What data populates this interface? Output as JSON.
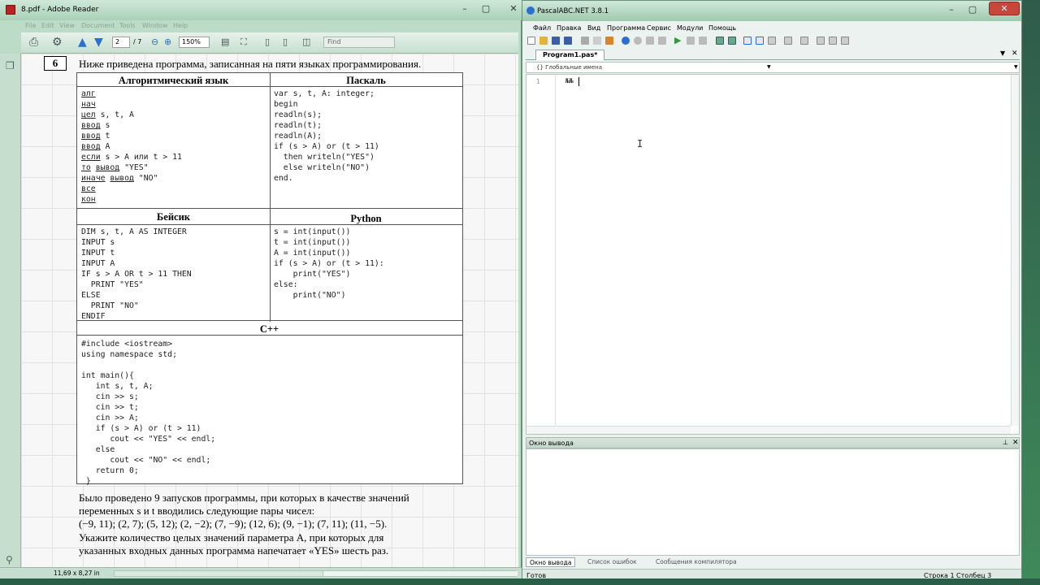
{
  "reader": {
    "title": "8.pdf - Adobe Reader",
    "menu": [
      "File",
      "Edit",
      "View",
      "Document",
      "Tools",
      "Window",
      "Help"
    ],
    "toolbar": {
      "page_value": "2",
      "page_total": "/ 7",
      "zoom_value": "150%",
      "find_placeholder": "Find"
    },
    "page": {
      "task_number": "6",
      "intro": "Ниже приведена программа, записанная на пяти языках программирования.",
      "headers": {
        "algo": "Алгоритмический язык",
        "pascal": "Паскаль",
        "basic": "Бейсик",
        "python": "Python",
        "cpp": "C++"
      },
      "code_algo": [
        {
          "kw": "алг",
          "rest": ""
        },
        {
          "kw": "нач",
          "rest": ""
        },
        {
          "kw": "цел",
          "rest": " s, t, A"
        },
        {
          "kw": "ввод",
          "rest": " s"
        },
        {
          "kw": "ввод",
          "rest": " t"
        },
        {
          "kw": "ввод",
          "rest": " A"
        },
        {
          "kw": "если",
          "rest": " s > A или t > 11"
        },
        {
          "kw": "то",
          "rest": " ",
          "kw2": "вывод",
          "rest2": " \"YES\""
        },
        {
          "kw": "иначе",
          "rest": " ",
          "kw2": "вывод",
          "rest2": " \"NO\""
        },
        {
          "kw": "все",
          "rest": ""
        },
        {
          "kw": "кон",
          "rest": ""
        }
      ],
      "code_pascal": "var s, t, A: integer;\nbegin\nreadln(s);\nreadln(t);\nreadln(A);\nif (s > A) or (t > 11)\n  then writeln(\"YES\")\n  else writeln(\"NO\")\nend.",
      "code_basic": "DIM s, t, A AS INTEGER\nINPUT s\nINPUT t\nINPUT A\nIF s > A OR t > 11 THEN\n  PRINT \"YES\"\nELSE\n  PRINT \"NO\"\nENDIF",
      "code_python": "s = int(input())\nt = int(input())\nA = int(input())\nif (s > A) or (t > 11):\n    print(\"YES\")\nelse:\n    print(\"NO\")",
      "code_cpp": "#include <iostream>\nusing namespace std;\n\nint main(){\n   int s, t, A;\n   cin >> s;\n   cin >> t;\n   cin >> A;\n   if (s > A) or (t > 11)\n      cout << \"YES\" << endl;\n   else\n      cout << \"NO\" << endl;\n   return 0;\n }",
      "para1": [
        "Было проведено 9 запусков программы, при которых в качестве значений",
        "переменных s и t вводились следующие пары чисел:",
        "(−9, 11); (2, 7); (5, 12); (2, −2); (7, −9); (12, 6); (9, −1); (7, 11); (11, −5)."
      ],
      "para2": [
        "Укажите количество целых значений параметра A, при которых для",
        "указанных входных данных программа напечатает «YES» шесть раз."
      ]
    },
    "status": {
      "page_size": "11,69 x 8,27 in"
    }
  },
  "pascal": {
    "title": "PascalABC.NET 3.8.1",
    "menu": [
      "Файл",
      "Правка",
      "Вид",
      "Программа",
      "Сервис",
      "Модули",
      "Помощь"
    ],
    "tab_label": "Program1.pas*",
    "scope": "{} Глобальные имена",
    "editor": {
      "line_number": "1",
      "code": "№№"
    },
    "output_title": "Окно вывода",
    "bottom_tabs": [
      "Окно вывода",
      "Список ошибок",
      "Сообщения компилятора"
    ],
    "status": {
      "ready": "Готов",
      "row": "Строка  1",
      "col": "Столбец  3"
    }
  },
  "colors": {
    "toolbar_green": "#2f9a3a",
    "toolbar_blue": "#2a6fd1",
    "toolbar_orange": "#d8842a",
    "close_red": "#c8473c"
  }
}
